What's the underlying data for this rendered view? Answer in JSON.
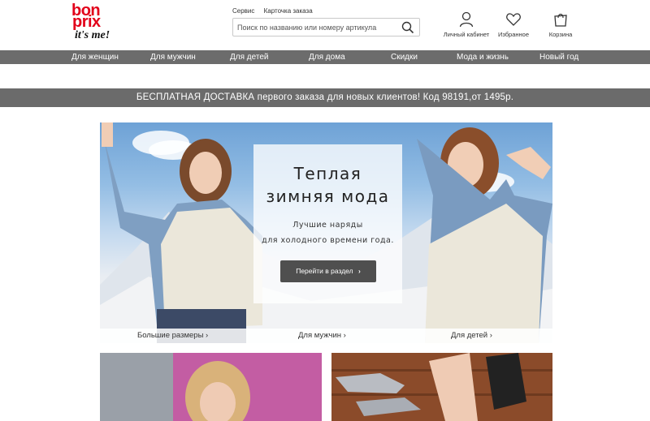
{
  "brand": {
    "line1": "bon",
    "line2": "prix",
    "tagline": "it's me!",
    "color": "#e2001a"
  },
  "top_links": [
    "Сервис",
    "Карточка заказа"
  ],
  "search": {
    "placeholder": "Поиск по названию или номеру артикула",
    "value": ""
  },
  "header_icons": [
    {
      "icon": "user-icon",
      "label": "Личный кабинет"
    },
    {
      "icon": "heart-icon",
      "label": "Избранное"
    },
    {
      "icon": "bag-icon",
      "label": "Корзина"
    }
  ],
  "nav": [
    "Для женщин",
    "Для мужчин",
    "Для детей",
    "Для дома",
    "Скидки",
    "Мода и жизнь",
    "Новый год"
  ],
  "promo": "БЕСПЛАТНАЯ ДОСТАВКА первого заказа для новых клиентов! Код 98191,от 1495р.",
  "hero": {
    "title_line1": "Теплая",
    "title_line2": "зимняя мода",
    "sub_line1": "Лучшие наряды",
    "sub_line2": "для холодного времени года.",
    "button": "Перейти в раздел",
    "links": [
      "Большие размеры ›",
      "Для мужчин ›",
      "Для детей ›"
    ]
  },
  "colors": {
    "nav_bg": "#6c6c6c",
    "promo_bg": "#6b6b6b",
    "button_bg": "#4f4f4f"
  }
}
